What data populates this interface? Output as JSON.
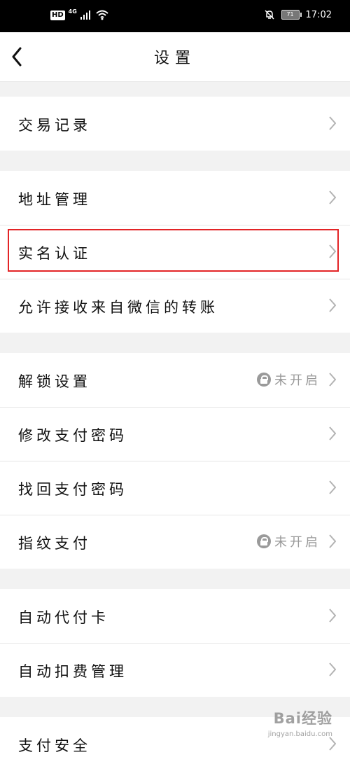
{
  "status_bar": {
    "hd": "HD",
    "network": "4G",
    "battery": "71",
    "time": "17:02",
    "icons": [
      "hd-badge",
      "signal-icon",
      "wifi-icon",
      "mute-bell-icon",
      "battery-icon"
    ]
  },
  "header": {
    "title": "设置",
    "back_icon": "chevron-left-icon"
  },
  "groups": [
    {
      "items": [
        {
          "label": "交易记录"
        }
      ]
    },
    {
      "items": [
        {
          "label": "地址管理"
        },
        {
          "label": "实名认证",
          "highlighted": true
        },
        {
          "label": "允许接收来自微信的转账"
        }
      ]
    },
    {
      "items": [
        {
          "label": "解锁设置",
          "status": "未开启",
          "status_icon": "lock-icon"
        },
        {
          "label": "修改支付密码"
        },
        {
          "label": "找回支付密码"
        },
        {
          "label": "指纹支付",
          "status": "未开启",
          "status_icon": "lock-icon"
        }
      ]
    },
    {
      "items": [
        {
          "label": "自动代付卡"
        },
        {
          "label": "自动扣费管理"
        }
      ]
    },
    {
      "items": [
        {
          "label": "支付安全"
        }
      ]
    }
  ],
  "watermark": {
    "main": "Bai经验",
    "sub": "jingyan.baidu.com"
  },
  "colors": {
    "highlight": "#e32426",
    "background": "#f2f2f2",
    "text": "#111111",
    "muted": "#999999"
  }
}
